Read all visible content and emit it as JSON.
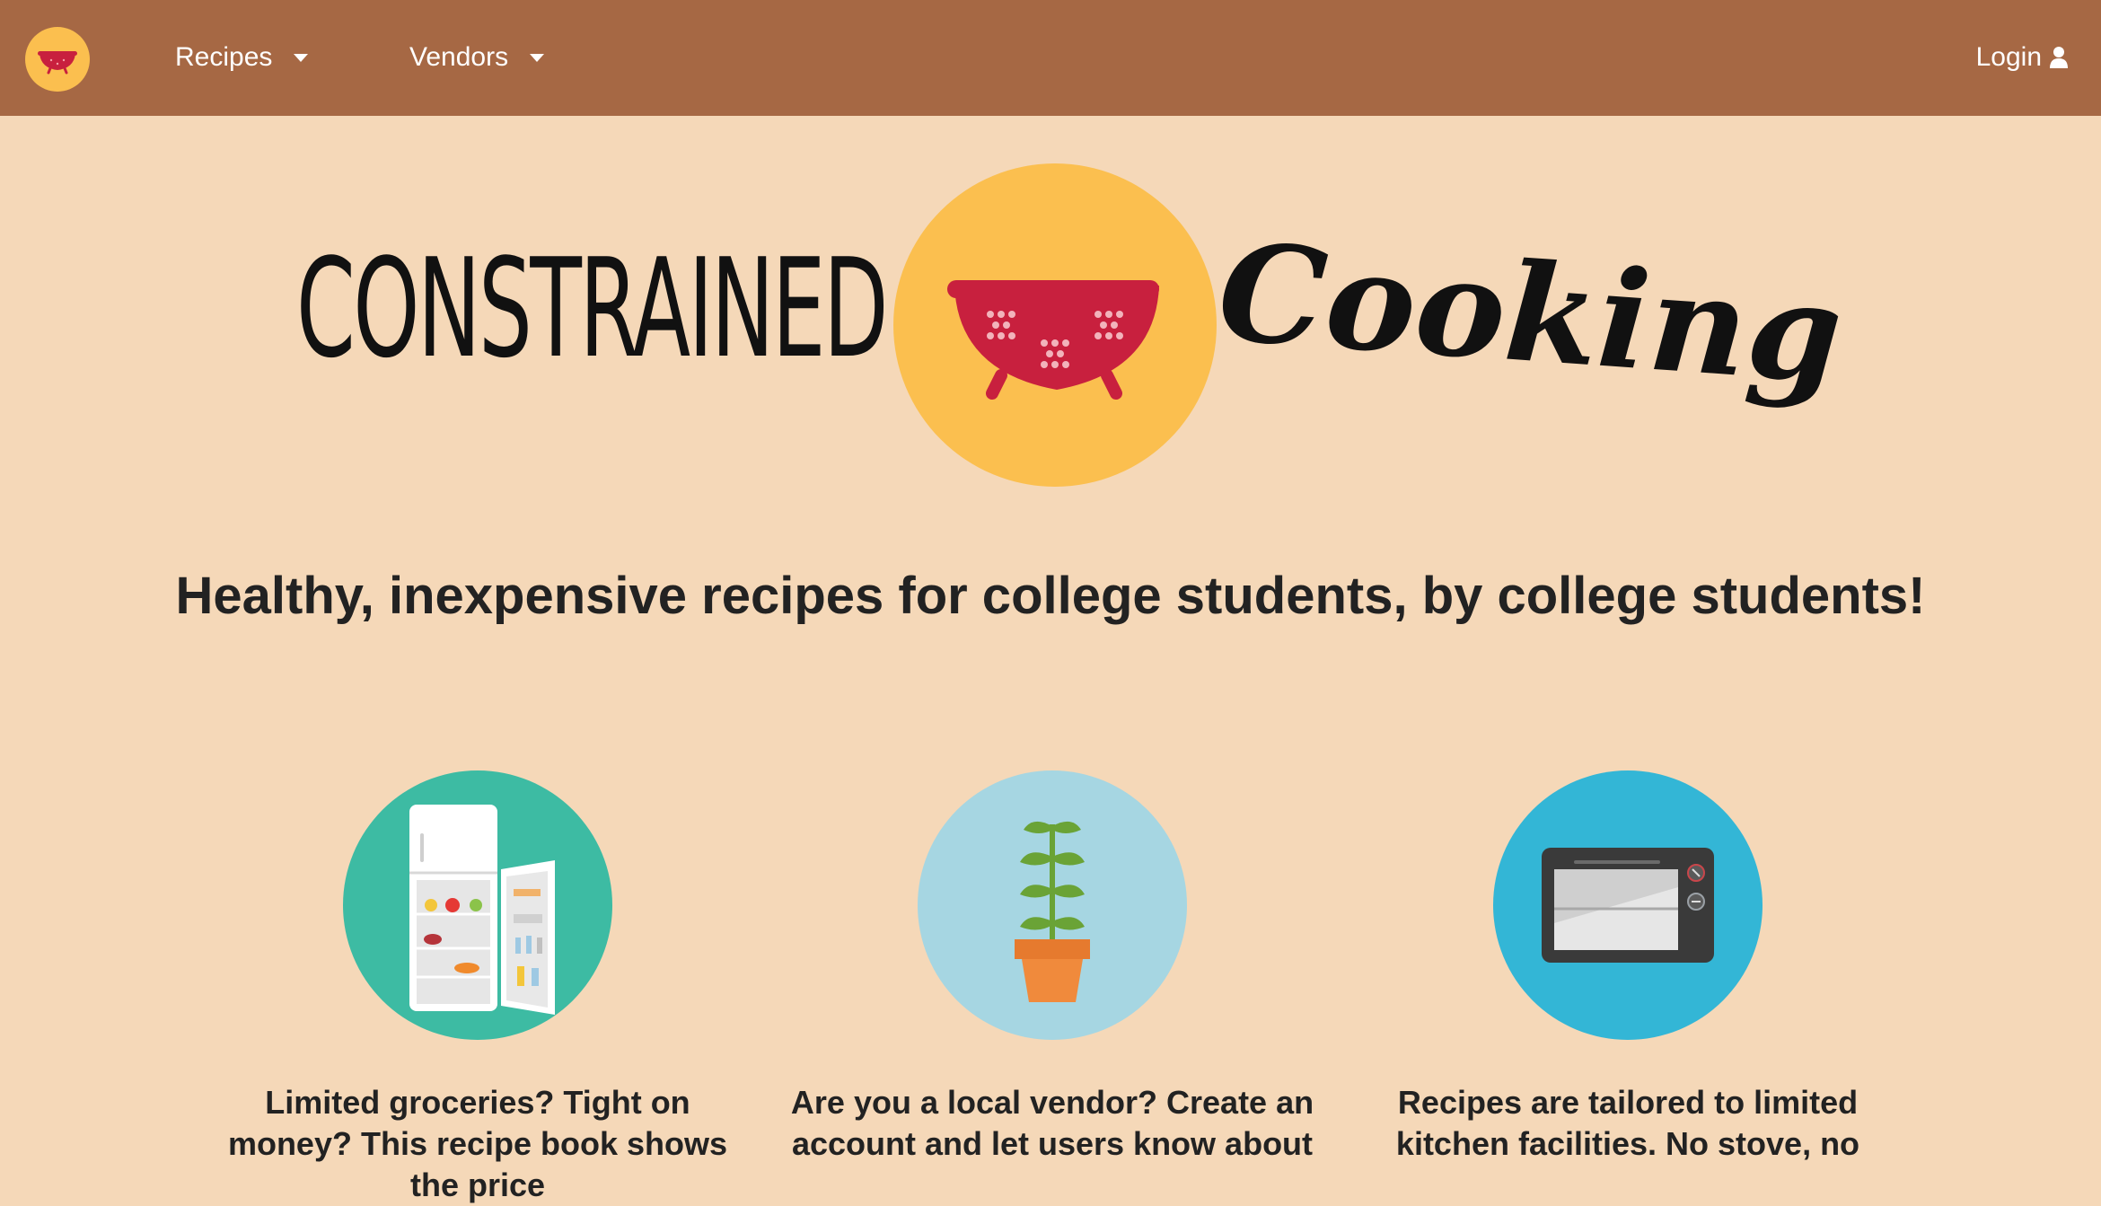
{
  "nav": {
    "logo_icon": "colander-icon",
    "recipes_label": "Recipes",
    "vendors_label": "Vendors",
    "login_label": "Login",
    "login_icon": "user-icon"
  },
  "hero": {
    "word_left": "CONSTRAINED",
    "word_right": "Cooking",
    "logo_icon": "colander-icon"
  },
  "tagline": "Healthy, inexpensive recipes for college students, by college students!",
  "features": [
    {
      "icon": "open-fridge-icon",
      "text": "Limited groceries? Tight on money? This recipe book shows the price"
    },
    {
      "icon": "potted-plant-icon",
      "text": "Are you a local vendor? Create an account and let users know about"
    },
    {
      "icon": "toaster-oven-icon",
      "text": "Recipes are tailored to limited kitchen facilities. No stove, no"
    }
  ],
  "colors": {
    "navbar": "#a66844",
    "page_background": "#f5d8b8",
    "logo_yellow": "#fbbf4f",
    "colander_red": "#c8203e",
    "fridge_circle": "#3dbba3",
    "plant_circle": "#a6d6e2",
    "oven_circle": "#33b6d6"
  }
}
